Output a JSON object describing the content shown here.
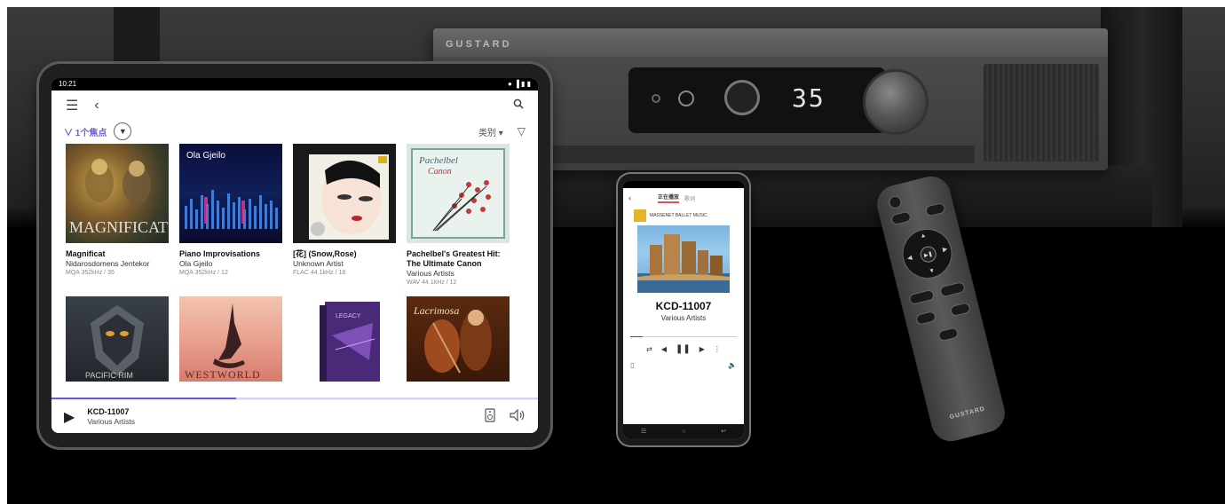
{
  "amplifier": {
    "brand": "GUSTARD",
    "display": "35"
  },
  "tablet": {
    "status_time": "10:21",
    "status_right": "● ▐ ▮ ▮",
    "filter": {
      "label": "∨ 1个焦点",
      "sort": "类别 ▾"
    },
    "albums": [
      {
        "title": "Magnificat",
        "artist": "Nidarosdomens Jentekor",
        "format": "MQA 352kHz / 35"
      },
      {
        "title": "Piano Improvisations",
        "artist": "Ola Gjeilo",
        "format": "MQA 352kHz / 12",
        "cover_text": "Ola Gjeilo"
      },
      {
        "title": "[花] (Snow,Rose)",
        "artist": "Unknown Artist",
        "format": "FLAC 44.1kHz / 18"
      },
      {
        "title": "Pachelbel's Greatest Hit: The Ultimate Canon",
        "artist": "Various Artists",
        "format": "WAV 44.1kHz / 12"
      },
      {
        "title": "",
        "artist": "",
        "format": ""
      },
      {
        "title": "",
        "artist": "",
        "format": ""
      },
      {
        "title": "",
        "artist": "",
        "format": ""
      },
      {
        "title": "",
        "artist": "",
        "format": ""
      }
    ],
    "now_playing": {
      "title": "KCD-11007",
      "artist": "Various Artists"
    }
  },
  "phone": {
    "tabs": [
      "正在播放",
      "歌词"
    ],
    "label_text": "MASSENET BALLET MUSIC",
    "title": "KCD-11007",
    "artist": "Various Artists"
  },
  "remote": {
    "brand": "GUSTARD"
  },
  "colors": {
    "accent": "#6b5cd6",
    "phone_tab_accent": "#e05050"
  }
}
